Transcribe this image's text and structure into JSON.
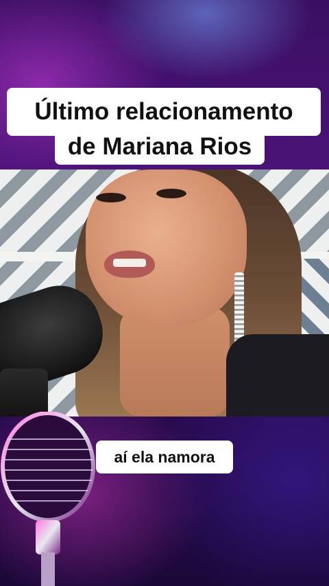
{
  "title": {
    "line1": "Último relacionamento",
    "line2": "de Mariana Rios"
  },
  "subtitle": "aí ela namora",
  "colors": {
    "caption_bg": "#ffffff",
    "caption_text": "#111111",
    "background_primary": "#3a0f62",
    "background_accent": "#c83cdc"
  }
}
